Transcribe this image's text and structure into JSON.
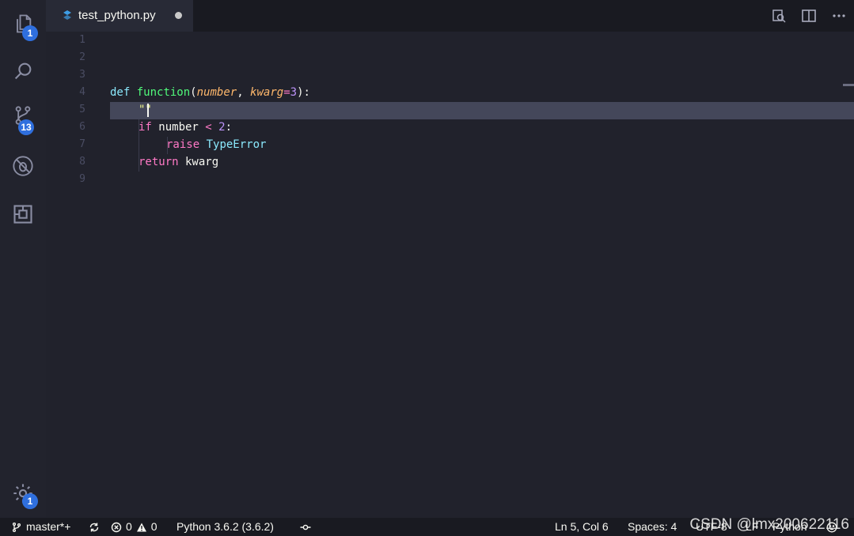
{
  "activity_bar": {
    "explorer_badge": "1",
    "scm_badge": "13",
    "settings_badge": "1"
  },
  "tab": {
    "title": "test_python.py"
  },
  "editor": {
    "line_numbers": [
      "1",
      "2",
      "3",
      "4",
      "5",
      "6",
      "7",
      "8",
      "9"
    ],
    "line4": {
      "kw_def": "def",
      "fn_name": "function",
      "open_paren": "(",
      "param1": "number",
      "comma": ", ",
      "param2": "kwarg",
      "eq": "=",
      "default": "3",
      "close": "):"
    },
    "line5": {
      "text": "\"\""
    },
    "line6": {
      "kw_if": "if",
      "var": " number ",
      "op": "<",
      "num": " 2",
      "colon": ":"
    },
    "line7": {
      "kw_raise": "raise",
      "cls": " TypeError"
    },
    "line8": {
      "kw_return": "return",
      "var": " kwarg"
    }
  },
  "status_bar": {
    "branch": "master*+",
    "errors": "0",
    "warnings": "0",
    "interpreter": "Python 3.6.2 (3.6.2)",
    "position": "Ln 5, Col 6",
    "spaces": "Spaces: 4",
    "encoding": "UTF-8",
    "eol": "LF",
    "language": "Python"
  },
  "watermark": "CSDN @lmx200622116",
  "colors": {
    "background": "#21222c",
    "current_line": "#44475a",
    "badge": "#2f6fde"
  }
}
